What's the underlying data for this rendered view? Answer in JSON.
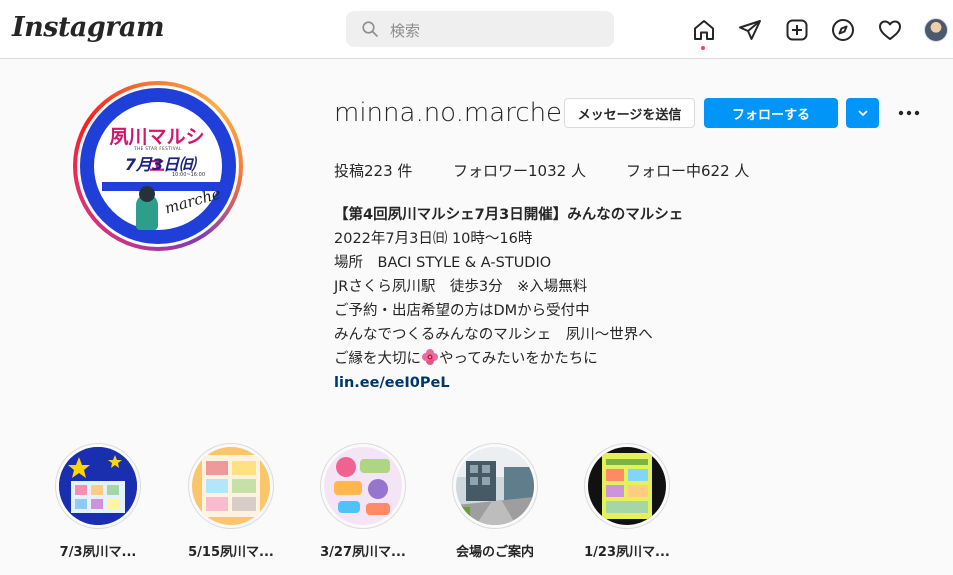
{
  "nav": {
    "logo": "Instagram",
    "search_placeholder": "検索",
    "icons": [
      "home-icon",
      "direct-send-icon",
      "new-post-icon",
      "explore-compass-icon",
      "activity-heart-icon",
      "profile-avatar"
    ]
  },
  "profile": {
    "username": "minna.no.marche",
    "message_button": "メッセージを送信",
    "follow_button": "フォローする",
    "stats": {
      "posts": "投稿223 件",
      "followers": "フォロワー1032 人",
      "following": "フォロー中622 人"
    },
    "bio": {
      "name": "【第4回夙川マルシェ7月3日開催】みんなのマルシェ",
      "line1": "2022年7月3日㈰ 10時〜16時",
      "line2": "場所　BACI STYLE & A-STUDIO",
      "line3": "JRさくら夙川駅　徒歩3分　※入場無料",
      "line4": "ご予約・出店希望の方はDMから受付中",
      "line5": "みんなでつくるみんなのマルシェ　夙川〜世界へ",
      "line6a": "ご縁を大切に",
      "line6b": "やってみたいをかたちに",
      "link": "lin.ee/eeI0PeL"
    },
    "avatar_text": {
      "title": "夙川マルシェ",
      "sub": "THE STAR FESTIVAL",
      "date": "7月3日㈰",
      "time": "10:00~16:00",
      "script": "marche"
    }
  },
  "highlights": [
    {
      "label": "7/3夙川マ..."
    },
    {
      "label": "5/15夙川マ..."
    },
    {
      "label": "3/27夙川マ..."
    },
    {
      "label": "会場のご案内"
    },
    {
      "label": "1/23夙川マ..."
    }
  ],
  "colors": {
    "accent": "#0095f6",
    "link": "#00376b",
    "notification_dot": "#ed4956"
  }
}
